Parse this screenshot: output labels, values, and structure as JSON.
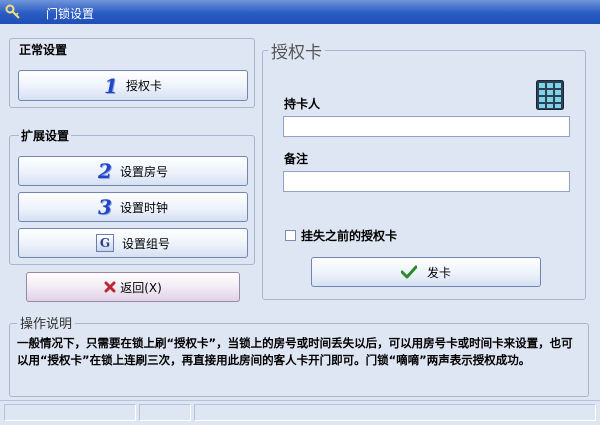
{
  "window": {
    "title": "门锁设置"
  },
  "normal_group": {
    "title": "正常设置",
    "auth_button": "授权卡",
    "auth_icon": "1"
  },
  "ext_group": {
    "title": "扩展设置",
    "room_button": "设置房号",
    "room_icon": "2",
    "clock_button": "设置时钟",
    "clock_icon": "3",
    "group_button": "设置组号",
    "group_icon": "G"
  },
  "back_button": "返回(X)",
  "auth_panel": {
    "title": "授权卡",
    "holder_label": "持卡人",
    "holder_value": "",
    "note_label": "备注",
    "note_value": "",
    "lost_checkbox_label": "挂失之前的授权卡",
    "lost_checked": false,
    "issue_button": "发卡"
  },
  "instructions": {
    "title": "操作说明",
    "text": "一般情况下，只需要在锁上刷“授权卡”，当锁上的房号或时间丢失以后，可以用房号卡或时间卡来设置，也可以用“授权卡”在锁上连刷三次，再直接用此房间的客人卡开门即可。门锁“嘀嘀”两声表示授权成功。"
  },
  "colors": {
    "title_bar": "#2a5cc4",
    "window_bg": "#dfe6f3",
    "icon_blue": "#1f47c8",
    "check_green": "#2c8a2c",
    "back_x": "#c0262f"
  }
}
